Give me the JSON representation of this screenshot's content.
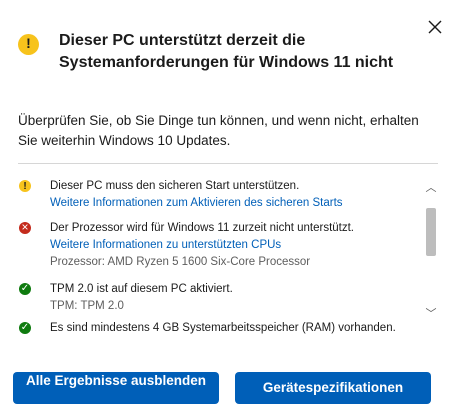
{
  "dialog": {
    "title": "Dieser PC unterstützt derzeit die Systemanforderungen für Windows 11 nicht",
    "intro": "Überprüfen Sie, ob Sie Dinge tun können, und wenn nicht, erhalten Sie weiterhin Windows 10 Updates.",
    "close_icon": "close-icon",
    "header_icon": "warning-icon"
  },
  "checks": [
    {
      "status": "warning",
      "text": "Dieser PC muss den sicheren Start unterstützen.",
      "link": "Weitere Informationen zum Aktivieren des sicheren Starts"
    },
    {
      "status": "error",
      "text": "Der Prozessor wird für Windows 11 zurzeit nicht unterstützt.",
      "link": "Weitere Informationen zu unterstützten CPUs",
      "detail": "Prozessor: AMD Ryzen 5 1600 Six-Core Processor"
    },
    {
      "status": "ok",
      "text": "TPM 2.0 ist auf diesem PC aktiviert.",
      "detail": "TPM: TPM 2.0"
    },
    {
      "status": "ok",
      "text": "Es sind mindestens 4 GB Systemarbeitsspeicher (RAM) vorhanden."
    }
  ],
  "buttons": {
    "hide_results": "Alle Ergebnisse ausblenden",
    "device_specs": "Gerätespezifikationen"
  },
  "colors": {
    "accent": "#005fb8",
    "warning": "#f7c31c",
    "error": "#c42b1c",
    "ok": "#0f7b0f"
  }
}
